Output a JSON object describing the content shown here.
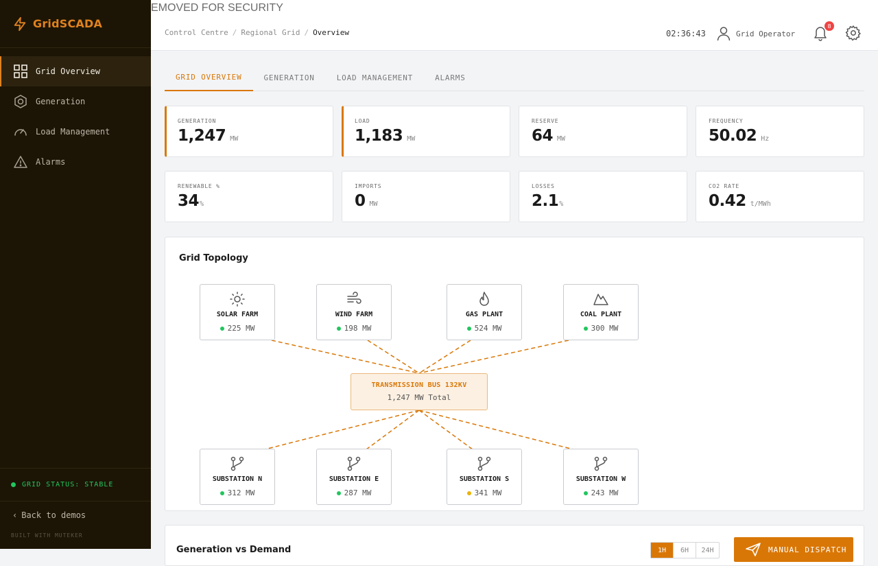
{
  "app": {
    "name": "GridSCADA",
    "banner": "EMOVED FOR SECURITY"
  },
  "sidebar": {
    "items": [
      {
        "label": "Grid Overview",
        "icon": "grid-icon"
      },
      {
        "label": "Generation",
        "icon": "hexagon-icon"
      },
      {
        "label": "Load Management",
        "icon": "gauge-icon"
      },
      {
        "label": "Alarms",
        "icon": "warning-icon"
      }
    ],
    "status": "GRID STATUS: STABLE",
    "back": "Back to demos",
    "built": "BUILT WITH MUTEKER"
  },
  "header": {
    "breadcrumbs": [
      "Control Centre",
      "Regional Grid",
      "Overview"
    ],
    "clock": "02:36:43",
    "user": "Grid Operator",
    "notifications": "8"
  },
  "tabs": [
    "GRID OVERVIEW",
    "GENERATION",
    "LOAD MANAGEMENT",
    "ALARMS"
  ],
  "kpis": [
    {
      "label": "GENERATION",
      "value": "1,247",
      "unit": "MW"
    },
    {
      "label": "LOAD",
      "value": "1,183",
      "unit": "MW"
    },
    {
      "label": "RESERVE",
      "value": "64",
      "unit": "MW"
    },
    {
      "label": "FREQUENCY",
      "value": "50.02",
      "unit": "Hz"
    },
    {
      "label": "RENEWABLE %",
      "value": "34",
      "unit": "%"
    },
    {
      "label": "IMPORTS",
      "value": "0",
      "unit": "MW"
    },
    {
      "label": "LOSSES",
      "value": "2.1",
      "unit": "%"
    },
    {
      "label": "CO2 RATE",
      "value": "0.42",
      "unit": "t/MWh"
    }
  ],
  "topology": {
    "title": "Grid Topology",
    "sources": [
      {
        "name": "SOLAR FARM",
        "value": "225 MW",
        "icon": "sun-icon",
        "status": "ok"
      },
      {
        "name": "WIND FARM",
        "value": "198 MW",
        "icon": "wind-icon",
        "status": "ok"
      },
      {
        "name": "GAS PLANT",
        "value": "524 MW",
        "icon": "flame-icon",
        "status": "ok"
      },
      {
        "name": "COAL PLANT",
        "value": "300 MW",
        "icon": "mountain-icon",
        "status": "ok"
      }
    ],
    "bus": {
      "name": "TRANSMISSION BUS 132KV",
      "total": "1,247 MW Total"
    },
    "substations": [
      {
        "name": "SUBSTATION N",
        "value": "312 MW",
        "icon": "branch-icon",
        "status": "ok"
      },
      {
        "name": "SUBSTATION E",
        "value": "287 MW",
        "icon": "branch-icon",
        "status": "ok"
      },
      {
        "name": "SUBSTATION S",
        "value": "341 MW",
        "icon": "branch-icon",
        "status": "warning"
      },
      {
        "name": "SUBSTATION W",
        "value": "243 MW",
        "icon": "branch-icon",
        "status": "ok"
      }
    ]
  },
  "bottom": {
    "title": "Generation vs Demand",
    "ranges": [
      "1H",
      "6H",
      "24H"
    ],
    "dispatch": "MANUAL DISPATCH"
  },
  "colors": {
    "accent": "#d97706",
    "sidebar": "#1c1505",
    "ok": "#22c55e",
    "warning": "#eab308",
    "alert": "#ef4444"
  }
}
